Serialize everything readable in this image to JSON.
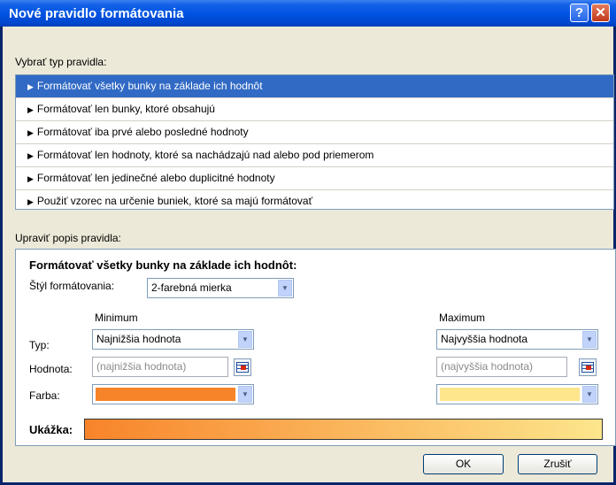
{
  "window": {
    "title": "Nové pravidlo formátovania",
    "help_icon": "?",
    "close_icon": "✕"
  },
  "select_type": {
    "label": "Vybrať typ pravidla:",
    "items": [
      "Formátovať všetky bunky na základe ich hodnôt",
      "Formátovať len bunky, ktoré obsahujú",
      "Formátovať iba prvé alebo posledné hodnoty",
      "Formátovať len hodnoty, ktoré sa nachádzajú nad alebo pod priemerom",
      "Formátovať len jedinečné alebo duplicitné hodnoty",
      "Použiť vzorec na určenie buniek, ktoré sa majú formátovať"
    ],
    "selected_index": 0
  },
  "edit": {
    "label": "Upraviť popis pravidla:",
    "heading": "Formátovať všetky bunky na základe ich hodnôt:",
    "style_label": "Štýl formátovania:",
    "style_value": "2-farebná mierka",
    "min_header": "Minimum",
    "max_header": "Maximum",
    "type_label": "Typ:",
    "value_label": "Hodnota:",
    "color_label": "Farba:",
    "min_type": "Najnižšia hodnota",
    "max_type": "Najvyššia hodnota",
    "min_value_placeholder": "(najnižšia hodnota)",
    "max_value_placeholder": "(najvyššia hodnota)",
    "min_color": "#f8842a",
    "max_color": "#fde68c",
    "preview_label": "Ukážka:"
  },
  "buttons": {
    "ok": "OK",
    "cancel": "Zrušiť"
  }
}
